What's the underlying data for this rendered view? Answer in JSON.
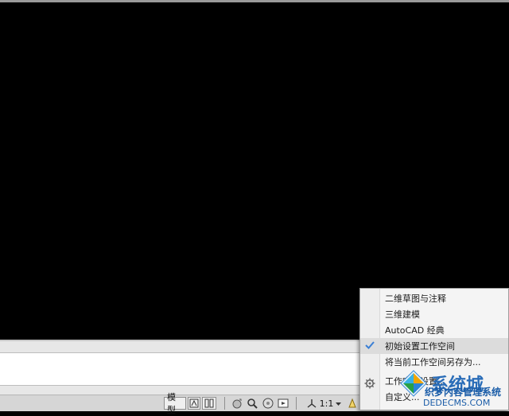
{
  "window_controls": {
    "restore": "restore-icon",
    "close": "close-icon",
    "minimize": "minimize-icon"
  },
  "statusbar": {
    "model_label": "模型",
    "scale_label": "1:1",
    "icons": [
      "layout-icon",
      "grid-icon",
      "pan-icon",
      "zoom-icon",
      "steering-wheel-icon",
      "showmotion-icon",
      "annotation-icon",
      "dropdown-icon",
      "workspace-icon"
    ]
  },
  "workspace_menu": {
    "items": [
      {
        "label": "二维草图与注释",
        "checked": false
      },
      {
        "label": "三维建模",
        "checked": false
      },
      {
        "label": "AutoCAD 经典",
        "checked": false
      },
      {
        "label": "初始设置工作空间",
        "checked": true
      },
      {
        "label": "将当前工作空间另存为...",
        "checked": false
      },
      {
        "label": "工作空间设置...",
        "checked": false
      },
      {
        "label": "自定义...",
        "checked": false
      }
    ]
  },
  "watermark": {
    "big": "系统城",
    "line1": "织梦内容管理系统",
    "line2": "DEDECMS.COM"
  },
  "colors": {
    "accent": "#3a7fd5",
    "canvas": "#000000"
  }
}
